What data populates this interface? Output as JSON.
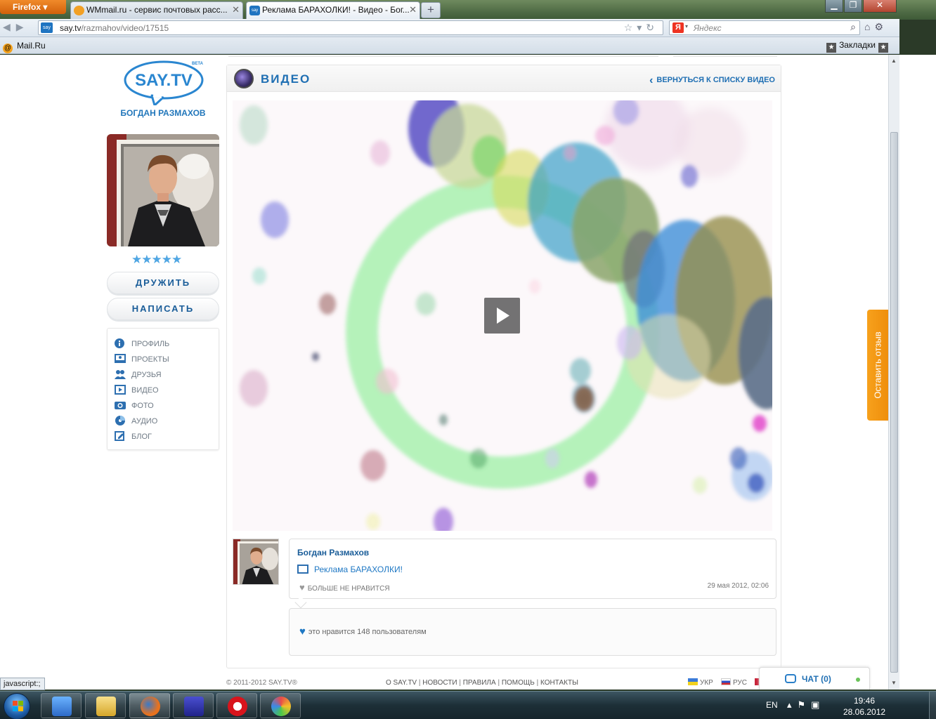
{
  "browser": {
    "app_button": "Firefox",
    "tabs": [
      {
        "title": "WMmail.ru - сервис почтовых расс...",
        "active": false
      },
      {
        "title": "Реклама БАРАХОЛКИ! - Видео - Бог...",
        "active": true
      }
    ],
    "url_host": "say.tv",
    "url_path": "/razmahov/video/17515",
    "search_placeholder": "Яндекс",
    "bookmark_left": "Mail.Ru",
    "bookmark_right": "Закладки",
    "status_text": "javascript:;"
  },
  "site": {
    "logo_text": "SAY.TV",
    "logo_badge": "BETA",
    "profile_name": "Богдан Размахов",
    "rating_stars": "★★★★★",
    "rating_value": 5,
    "btn_friend": "Дружить",
    "btn_write": "Написать",
    "menu": [
      {
        "label": "Профиль",
        "icon": "info-icon"
      },
      {
        "label": "Проекты",
        "icon": "projects-icon"
      },
      {
        "label": "Друзья",
        "icon": "friends-icon"
      },
      {
        "label": "Видео",
        "icon": "video-icon"
      },
      {
        "label": "Фото",
        "icon": "camera-icon"
      },
      {
        "label": "Аудио",
        "icon": "audio-icon"
      },
      {
        "label": "Блог",
        "icon": "blog-icon"
      }
    ],
    "feedback": "Оставить отзыв"
  },
  "panel": {
    "title": "Видео",
    "back_link": "Вернуться к списку видео"
  },
  "post": {
    "author": "Богдан Размахов",
    "title": "Реклама БАРАХОЛКИ!",
    "unlike": "Больше не нравится",
    "date": "29 мая 2012, 02:06",
    "likes": "это нравится 148 пользователям"
  },
  "footer": {
    "copyright": "© 2011-2012 SAY.TV®",
    "links": [
      "О SAY.TV",
      "Новости",
      "Правила",
      "Помощь",
      "Контакты"
    ],
    "lang_ukr": "УКР",
    "lang_rus": "РУС"
  },
  "chat": {
    "label": "Чат (0)"
  },
  "taskbar": {
    "lang": "EN",
    "time": "19:46",
    "date": "28.06.2012"
  },
  "colors": {
    "accent": "#1f6fb3",
    "feedback": "#f39a14",
    "star": "#4fa6e3"
  }
}
